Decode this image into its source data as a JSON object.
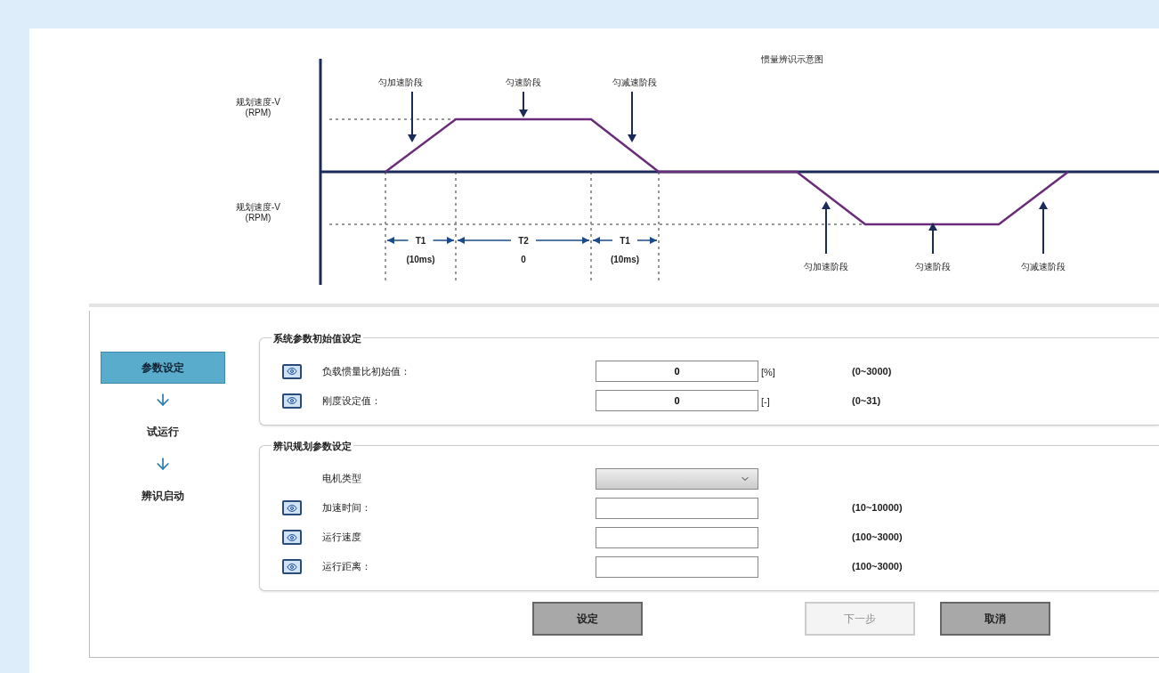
{
  "diagram": {
    "title": "惯量辨识示意图",
    "axis_labels": [
      {
        "text": "规划速度-V",
        "unit": "(RPM)"
      },
      {
        "text": "规划速度-V",
        "unit": "(RPM)"
      }
    ],
    "phase_labels": [
      "匀加速阶段",
      "匀速阶段",
      "匀减速阶段",
      "匀加速阶段",
      "匀速阶段",
      "匀减速阶段"
    ],
    "intervals": [
      {
        "name": "T1",
        "value": "(10ms)"
      },
      {
        "name": "T2",
        "value": "0"
      },
      {
        "name": "T1",
        "value": "(10ms)"
      }
    ]
  },
  "steps": [
    {
      "label": "参数设定",
      "selected": true
    },
    {
      "label": "试运行",
      "selected": false
    },
    {
      "label": "辨识启动",
      "selected": false
    }
  ],
  "groups": [
    {
      "title": "系统参数初始值设定",
      "rows": [
        {
          "kind": "input",
          "label": "负载惯量比初始值：",
          "value": "0",
          "unit": "[%]",
          "range": "(0~3000)"
        },
        {
          "kind": "input",
          "label": "刚度设定值：",
          "value": "0",
          "unit": "[-]",
          "range": "(0~31)"
        }
      ]
    },
    {
      "title": "辨识规划参数设定",
      "rows": [
        {
          "kind": "select",
          "label": "电机类型"
        },
        {
          "kind": "input",
          "label": "加速时间：",
          "range": "(10~10000)"
        },
        {
          "kind": "input",
          "label": "运行速度",
          "range": "(100~3000)"
        },
        {
          "kind": "input",
          "label": "运行距离：",
          "range": "(100~3000)"
        }
      ]
    }
  ],
  "buttons": [
    {
      "label": "设定",
      "disabled": false
    },
    {
      "label": "下一步",
      "disabled": true
    },
    {
      "label": "取消",
      "disabled": false
    }
  ]
}
